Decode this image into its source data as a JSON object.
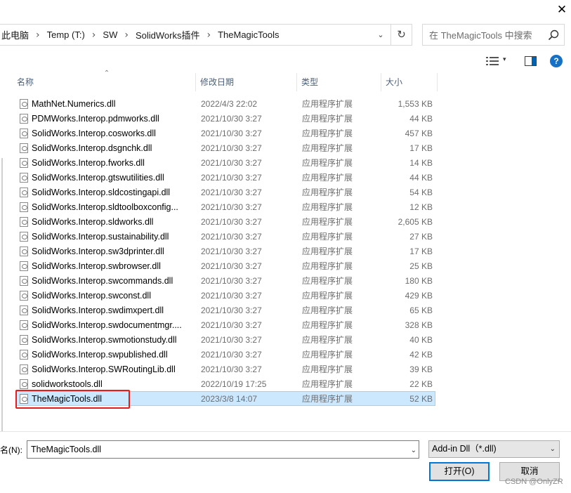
{
  "window": {
    "close_glyph": "✕"
  },
  "address_bar": {
    "breadcrumbs": [
      "此电脑",
      "Temp (T:)",
      "SW",
      "SolidWorks插件",
      "TheMagicTools"
    ],
    "separator_glyph": "›",
    "dropdown_glyph": "⌄",
    "refresh_glyph": "↻"
  },
  "search": {
    "placeholder": "在 TheMagicTools 中搜索",
    "icon": "search-icon"
  },
  "toolbar": {
    "view_icon": "view-details-icon",
    "view_dropdown_glyph": "▾",
    "preview_pane_icon": "preview-pane-icon",
    "help_label": "?"
  },
  "columns": {
    "sort_glyph": "⌃",
    "name": "名称",
    "date": "修改日期",
    "type": "类型",
    "size": "大小"
  },
  "files": [
    {
      "name": "MathNet.Numerics.dll",
      "date": "2022/4/3 22:02",
      "type": "应用程序扩展",
      "size": "1,553 KB"
    },
    {
      "name": "PDMWorks.Interop.pdmworks.dll",
      "date": "2021/10/30 3:27",
      "type": "应用程序扩展",
      "size": "44 KB"
    },
    {
      "name": "SolidWorks.Interop.cosworks.dll",
      "date": "2021/10/30 3:27",
      "type": "应用程序扩展",
      "size": "457 KB"
    },
    {
      "name": "SolidWorks.Interop.dsgnchk.dll",
      "date": "2021/10/30 3:27",
      "type": "应用程序扩展",
      "size": "17 KB"
    },
    {
      "name": "SolidWorks.Interop.fworks.dll",
      "date": "2021/10/30 3:27",
      "type": "应用程序扩展",
      "size": "14 KB"
    },
    {
      "name": "SolidWorks.Interop.gtswutilities.dll",
      "date": "2021/10/30 3:27",
      "type": "应用程序扩展",
      "size": "44 KB"
    },
    {
      "name": "SolidWorks.Interop.sldcostingapi.dll",
      "date": "2021/10/30 3:27",
      "type": "应用程序扩展",
      "size": "54 KB"
    },
    {
      "name": "SolidWorks.Interop.sldtoolboxconfig...",
      "date": "2021/10/30 3:27",
      "type": "应用程序扩展",
      "size": "12 KB"
    },
    {
      "name": "SolidWorks.Interop.sldworks.dll",
      "date": "2021/10/30 3:27",
      "type": "应用程序扩展",
      "size": "2,605 KB"
    },
    {
      "name": "SolidWorks.Interop.sustainability.dll",
      "date": "2021/10/30 3:27",
      "type": "应用程序扩展",
      "size": "27 KB"
    },
    {
      "name": "SolidWorks.Interop.sw3dprinter.dll",
      "date": "2021/10/30 3:27",
      "type": "应用程序扩展",
      "size": "17 KB"
    },
    {
      "name": "SolidWorks.Interop.swbrowser.dll",
      "date": "2021/10/30 3:27",
      "type": "应用程序扩展",
      "size": "25 KB"
    },
    {
      "name": "SolidWorks.Interop.swcommands.dll",
      "date": "2021/10/30 3:27",
      "type": "应用程序扩展",
      "size": "180 KB"
    },
    {
      "name": "SolidWorks.Interop.swconst.dll",
      "date": "2021/10/30 3:27",
      "type": "应用程序扩展",
      "size": "429 KB"
    },
    {
      "name": "SolidWorks.Interop.swdimxpert.dll",
      "date": "2021/10/30 3:27",
      "type": "应用程序扩展",
      "size": "65 KB"
    },
    {
      "name": "SolidWorks.Interop.swdocumentmgr....",
      "date": "2021/10/30 3:27",
      "type": "应用程序扩展",
      "size": "328 KB"
    },
    {
      "name": "SolidWorks.Interop.swmotionstudy.dll",
      "date": "2021/10/30 3:27",
      "type": "应用程序扩展",
      "size": "40 KB"
    },
    {
      "name": "SolidWorks.Interop.swpublished.dll",
      "date": "2021/10/30 3:27",
      "type": "应用程序扩展",
      "size": "42 KB"
    },
    {
      "name": "SolidWorks.Interop.SWRoutingLib.dll",
      "date": "2021/10/30 3:27",
      "type": "应用程序扩展",
      "size": "39 KB"
    },
    {
      "name": "solidworkstools.dll",
      "date": "2022/10/19 17:25",
      "type": "应用程序扩展",
      "size": "22 KB"
    },
    {
      "name": "TheMagicTools.dll",
      "date": "2023/3/8 14:07",
      "type": "应用程序扩展",
      "size": "52 KB",
      "selected": true
    }
  ],
  "footer": {
    "filename_label": "名(N):",
    "filename_value": "TheMagicTools.dll",
    "filetype_value": "Add-in Dll（*.dll)",
    "dropdown_glyph": "⌄",
    "open_label": "打开(O)",
    "cancel_label": "取消",
    "watermark": "CSDN @OnlyZR"
  },
  "colors": {
    "selection": "#cce8ff",
    "highlight_box": "#e02020",
    "accent": "#0078d7"
  }
}
